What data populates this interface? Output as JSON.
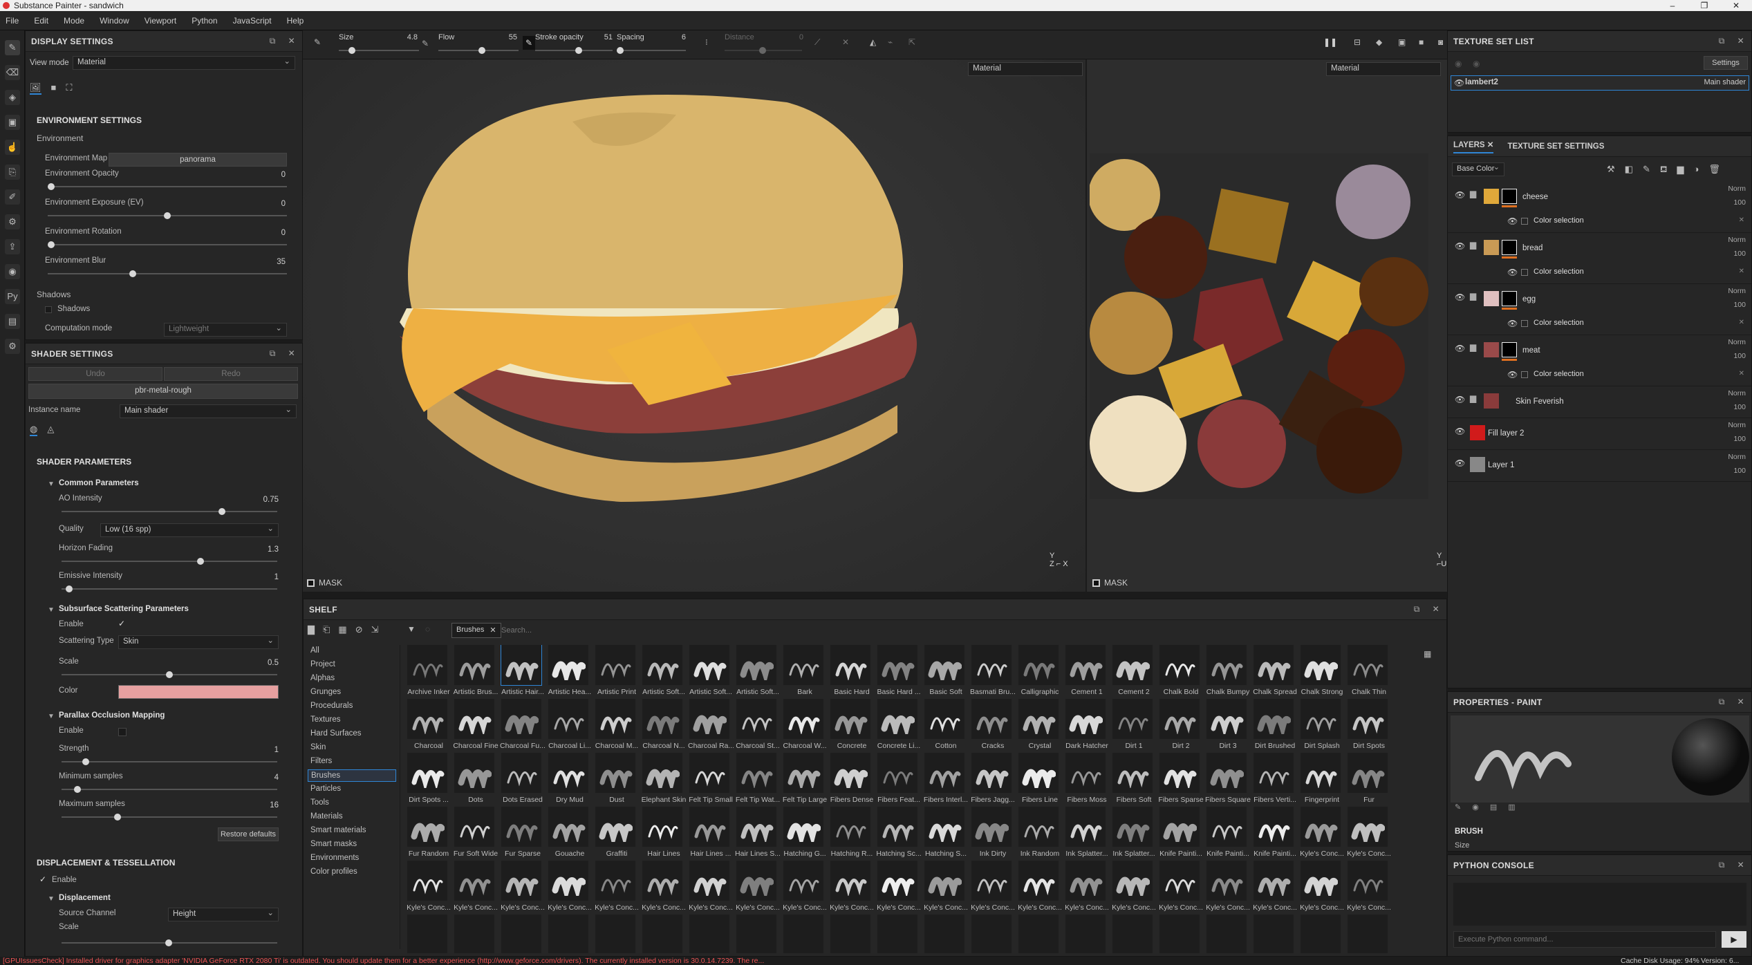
{
  "window": {
    "title": "Substance Painter - sandwich",
    "controls": [
      "–",
      "❐",
      "✕"
    ]
  },
  "menu": [
    "File",
    "Edit",
    "Mode",
    "Window",
    "Viewport",
    "Python",
    "JavaScript",
    "Help"
  ],
  "display_settings": {
    "title": "DISPLAY SETTINGS",
    "view_mode_label": "View mode",
    "view_mode_value": "Material",
    "env_section": "ENVIRONMENT SETTINGS",
    "environment_label": "Environment",
    "environment_map_label": "Environment Map",
    "environment_map_value": "panorama",
    "sliders": [
      {
        "label": "Environment Opacity",
        "value": "0",
        "pos": 0.0
      },
      {
        "label": "Environment Exposure (EV)",
        "value": "0",
        "pos": 0.5
      },
      {
        "label": "Environment Rotation",
        "value": "0",
        "pos": 0.0
      },
      {
        "label": "Environment Blur",
        "value": "35",
        "pos": 0.35
      }
    ],
    "shadows_section": "Shadows",
    "shadows_checkbox": "Shadows",
    "computation_label": "Computation mode",
    "computation_value": "Lightweight"
  },
  "shader_settings": {
    "title": "SHADER SETTINGS",
    "undo": "Undo",
    "redo": "Redo",
    "shader_name": "pbr-metal-rough",
    "instance_label": "Instance name",
    "instance_value": "Main shader",
    "params_section": "SHADER PARAMETERS",
    "common_section": "Common Parameters",
    "ao_label": "AO Intensity",
    "ao_value": "0.75",
    "ao_pos": 0.75,
    "quality_label": "Quality",
    "quality_value": "Low (16 spp)",
    "horizon_label": "Horizon Fading",
    "horizon_value": "1.3",
    "horizon_pos": 0.65,
    "emissive_label": "Emissive Intensity",
    "emissive_value": "1",
    "emissive_pos": 0.02,
    "sss_section": "Subsurface Scattering Parameters",
    "enable_label": "Enable",
    "scattering_type_label": "Scattering Type",
    "scattering_type_value": "Skin",
    "scale_label": "Scale",
    "scale_value": "0.5",
    "scale_pos": 0.5,
    "color_label": "Color",
    "color_swatch": "#e6a0a0",
    "pom_section": "Parallax Occlusion Mapping",
    "pom_enable": "Enable",
    "strength_label": "Strength",
    "strength_value": "1",
    "strength_pos": 0.1,
    "min_label": "Minimum samples",
    "min_value": "4",
    "min_pos": 0.06,
    "max_label": "Maximum samples",
    "max_value": "16",
    "max_pos": 0.25,
    "restore": "Restore defaults",
    "disp_section": "DISPLACEMENT & TESSELLATION",
    "disp_enable": "Enable",
    "disp_sub": "Displacement",
    "source_label": "Source Channel",
    "source_value": "Height",
    "disp_scale_label": "Scale"
  },
  "toolbar": {
    "size_label": "Size",
    "size_value": "4.8",
    "flow_label": "Flow",
    "flow_value": "55",
    "stroke_label": "Stroke opacity",
    "stroke_value": "51",
    "spacing_label": "Spacing",
    "spacing_value": "6",
    "distance_label": "Distance",
    "distance_value": "0"
  },
  "viewport_3d": {
    "mode": "Material",
    "mask_label": "MASK"
  },
  "viewport_2d": {
    "mode": "Material",
    "mask_label": "MASK"
  },
  "texture_set_list": {
    "title": "TEXTURE SET LIST",
    "settings": "Settings",
    "item_name": "lambert2",
    "item_shader": "Main shader"
  },
  "layers_panel": {
    "tab_layers": "LAYERS",
    "tab_tss": "TEXTURE SET SETTINGS",
    "channel": "Base Color",
    "layers": [
      {
        "name": "cheese",
        "blend": "Norm",
        "opacity": "100",
        "color": "#e0a83a",
        "sub": "Color selection"
      },
      {
        "name": "bread",
        "blend": "Norm",
        "opacity": "100",
        "color": "#c99a55",
        "sub": "Color selection"
      },
      {
        "name": "egg",
        "blend": "Norm",
        "opacity": "100",
        "color": "#e0c0c0",
        "sub": "Color selection"
      },
      {
        "name": "meat",
        "blend": "Norm",
        "opacity": "100",
        "color": "#9a4a4a",
        "sub": "Color selection"
      },
      {
        "name": "Skin Feverish",
        "blend": "Norm",
        "opacity": "100",
        "color": "#8a3b3b",
        "sub": ""
      },
      {
        "name": "Fill layer 2",
        "blend": "Norm",
        "opacity": "100",
        "color": "#d11b1b",
        "sub": ""
      },
      {
        "name": "Layer 1",
        "blend": "Norm",
        "opacity": "100",
        "color": "#888888",
        "sub": ""
      }
    ]
  },
  "properties": {
    "title": "PROPERTIES - PAINT",
    "brush_label": "BRUSH",
    "size_label": "Size"
  },
  "python_console": {
    "title": "PYTHON CONSOLE",
    "placeholder": "Execute Python command..."
  },
  "shelf": {
    "title": "SHELF",
    "filter_tag": "Brushes",
    "search_placeholder": "Search...",
    "categories": [
      "All",
      "Project",
      "Alphas",
      "Grunges",
      "Procedurals",
      "Textures",
      "Hard Surfaces",
      "Skin",
      "Filters",
      "Brushes",
      "Particles",
      "Tools",
      "Materials",
      "Smart materials",
      "Smart masks",
      "Environments",
      "Color profiles"
    ],
    "selected_category": "Brushes",
    "brushes": [
      "Archive Inker",
      "Artistic Brus...",
      "Artistic Hair...",
      "Artistic Hea...",
      "Artistic Print",
      "Artistic Soft...",
      "Artistic Soft...",
      "Artistic Soft...",
      "Bark",
      "Basic Hard",
      "Basic Hard ...",
      "Basic Soft",
      "Basmati Bru...",
      "Calligraphic",
      "Cement 1",
      "Cement 2",
      "Chalk Bold",
      "Chalk Bumpy",
      "Chalk Spread",
      "Chalk Strong",
      "Chalk Thin",
      "Charcoal",
      "Charcoal Fine",
      "Charcoal Fu...",
      "Charcoal Li...",
      "Charcoal M...",
      "Charcoal N...",
      "Charcoal Ra...",
      "Charcoal St...",
      "Charcoal W...",
      "Concrete",
      "Concrete Li...",
      "Cotton",
      "Cracks",
      "Crystal",
      "Dark Hatcher",
      "Dirt 1",
      "Dirt 2",
      "Dirt 3",
      "Dirt Brushed",
      "Dirt Splash",
      "Dirt Spots",
      "Dirt Spots ...",
      "Dots",
      "Dots Erased",
      "Dry Mud",
      "Dust",
      "Elephant Skin",
      "Felt Tip Small",
      "Felt Tip Wat...",
      "Felt Tip Large",
      "Fibers Dense",
      "Fibers Feat...",
      "Fibers Interl...",
      "Fibers Jagg...",
      "Fibers Line",
      "Fibers Moss",
      "Fibers Soft",
      "Fibers Sparse",
      "Fibers Square",
      "Fibers Verti...",
      "Fingerprint",
      "Fur",
      "Fur Random",
      "Fur Soft Wide",
      "Fur Sparse",
      "Gouache",
      "Graffiti",
      "Hair Lines",
      "Hair Lines ...",
      "Hair Lines S...",
      "Hatching G...",
      "Hatching R...",
      "Hatching Sc...",
      "Hatching S...",
      "Ink Dirty",
      "Ink Random",
      "Ink Splatter...",
      "Ink Splatter...",
      "Knife Painti...",
      "Knife Painti...",
      "Knife Painti...",
      "Kyle's Conc...",
      "Kyle's Conc...",
      "Kyle's Conc...",
      "Kyle's Conc...",
      "Kyle's Conc...",
      "Kyle's Conc...",
      "Kyle's Conc...",
      "Kyle's Conc...",
      "Kyle's Conc...",
      "Kyle's Conc...",
      "Kyle's Conc...",
      "Kyle's Conc...",
      "Kyle's Conc...",
      "Kyle's Conc...",
      "Kyle's Conc...",
      "Kyle's Conc...",
      "Kyle's Conc...",
      "Kyle's Conc...",
      "Kyle's Conc...",
      "Kyle's Conc...",
      "Kyle's Conc...",
      "Kyle's Conc...",
      "Kyle's Conc..."
    ],
    "selected_brush_index": 2
  },
  "status": {
    "warning": "[GPUIssuesCheck] Installed driver for graphics adapter 'NVIDIA GeForce RTX 2080 Ti' is outdated. You should update them for a better experience (http://www.geforce.com/drivers). The currently installed version is 30.0.14.7239. The re...",
    "cache_label": "Cache Disk Usage:",
    "cache_value": "94%",
    "version": "Version: 6..."
  }
}
